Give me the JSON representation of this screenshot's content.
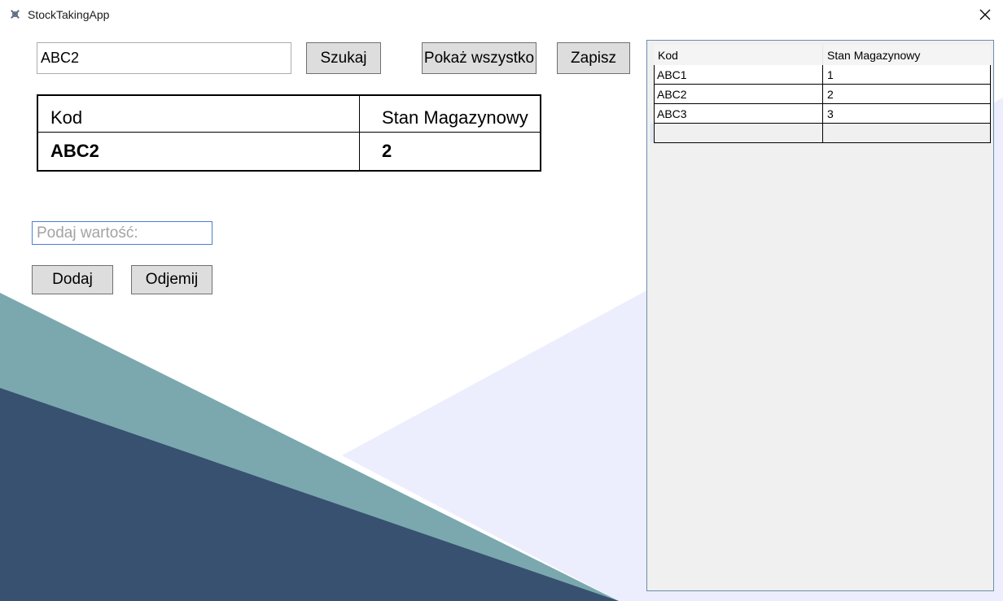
{
  "window": {
    "title": "StockTakingApp",
    "close_glyph": "✕"
  },
  "search": {
    "value": "ABC2"
  },
  "buttons": {
    "search": "Szukaj",
    "show_all": "Pokaż wszystko",
    "save": "Zapisz",
    "add": "Dodaj",
    "subtract": "Odjemij"
  },
  "result": {
    "headers": [
      "Kod",
      "Stan Magazynowy"
    ],
    "row": [
      "ABC2",
      "2"
    ]
  },
  "value_input": {
    "placeholder": "Podaj wartość:"
  },
  "grid": {
    "headers": [
      "Kod",
      "Stan Magazynowy"
    ],
    "rows": [
      [
        "ABC1",
        "1"
      ],
      [
        "ABC2",
        "2"
      ],
      [
        "ABC3",
        "3"
      ]
    ]
  },
  "colors": {
    "teal_shape": "#7aa8ae",
    "navy_shape": "#385170",
    "lavender_shape": "#eceefd",
    "button_bg": "#dddddd"
  }
}
